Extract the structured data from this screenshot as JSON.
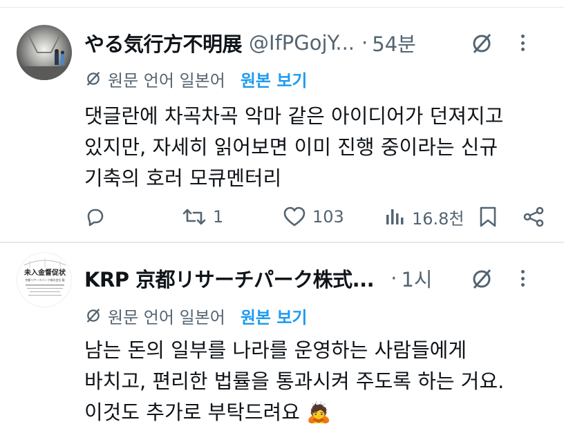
{
  "posts": [
    {
      "name": "やる気行方不明展",
      "handle": "@IfPGojY...",
      "separator": "·",
      "time": "54분",
      "translation": {
        "label": "원문 언어 일본어",
        "show_original": "원본 보기"
      },
      "text_lines": [
        "댓글란에 차곡차곡 악마 같은 아이디어가 던져지고",
        "있지만, 자세히 읽어보면 이미 진행 중이라는 신규",
        "기축의 호러 모큐멘터리"
      ],
      "actions": {
        "reply_count": "",
        "repost_count": "1",
        "like_count": "103",
        "view_count": "16.8천"
      }
    },
    {
      "name": "KRP 京都リサーチパーク株式...",
      "handle": "",
      "separator": "·",
      "time": "1시",
      "translation": {
        "label": "원문 언어 일본어",
        "show_original": "원본 보기"
      },
      "text_lines": [
        "남는 돈의 일부를 나라를 운영하는 사람들에게",
        "바치고, 편리한 법률을 통과시켜 주도록 하는 거요.",
        "이것도 추가로 부탁드려요 🙇"
      ],
      "avatar_text": {
        "headline": "未入金督促状",
        "company": "京都リサーチパーク株式会社 殿"
      }
    }
  ],
  "colors": {
    "accent": "#1d9bf0",
    "secondary_text": "#536471",
    "primary_text": "#0f1419",
    "divider": "#e6e8ea"
  },
  "icons": {
    "grok": "grok-icon",
    "more": "more-icon",
    "translate": "translate-icon",
    "reply": "reply-icon",
    "repost": "repost-icon",
    "like": "heart-icon",
    "views": "views-icon",
    "bookmark": "bookmark-icon",
    "share": "share-icon"
  }
}
